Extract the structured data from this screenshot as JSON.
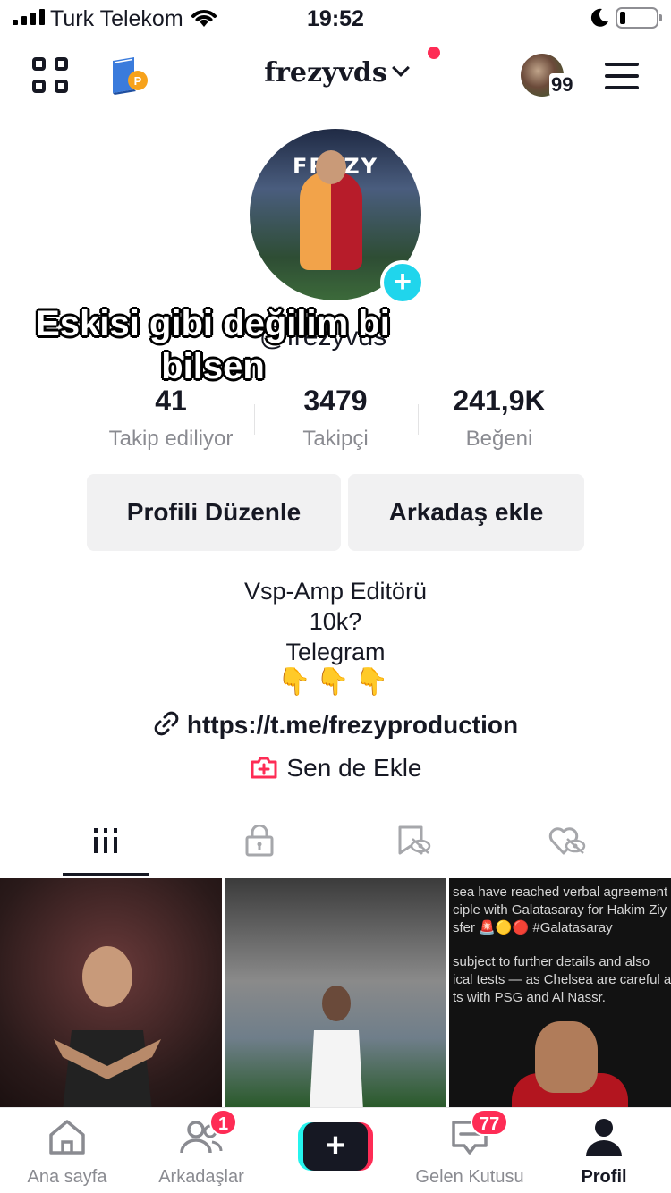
{
  "status_bar": {
    "carrier": "Turk Telekom",
    "time": "19:52"
  },
  "header": {
    "username": "frezyvds",
    "story_count": "99",
    "icons": [
      "qr-code-icon",
      "book-coin-icon",
      "chevron-down-icon",
      "menu-icon"
    ]
  },
  "profile": {
    "avatar_text": "FREZY",
    "handle": "@frezyvds",
    "overlay_caption": "Eskisi gibi değilim bi bilsen",
    "stats": [
      {
        "value": "41",
        "label": "Takip ediliyor"
      },
      {
        "value": "3479",
        "label": "Takipçi"
      },
      {
        "value": "241,9K",
        "label": "Beğeni"
      }
    ],
    "buttons": {
      "edit": "Profili Düzenle",
      "add_friend": "Arkadaş ekle"
    },
    "bio_lines": [
      "Vsp-Amp Editörü",
      "10k?",
      "Telegram",
      "👇👇👇"
    ],
    "link": "https://t.me/frezyproduction",
    "add_prompt": "Sen de Ekle"
  },
  "tabs": [
    "grid-icon",
    "lock-icon",
    "bookmark-hidden-icon",
    "heart-hidden-icon"
  ],
  "grid": {
    "tweet_lines": [
      "sea have reached verbal agreement",
      "ciple with Galatasaray for Hakim Ziy",
      "sfer 🚨🟡🔴 #Galatasaray",
      "",
      "subject to further details and also",
      "ical tests — as Chelsea are careful a",
      "ts with PSG and Al Nassr."
    ]
  },
  "bottom_nav": {
    "items": [
      {
        "label": "Ana sayfa",
        "icon": "home-icon"
      },
      {
        "label": "Arkadaşlar",
        "icon": "friends-icon",
        "badge": "1"
      },
      {
        "label": "",
        "icon": "create-plus-icon"
      },
      {
        "label": "Gelen Kutusu",
        "icon": "inbox-icon",
        "badge": "77"
      },
      {
        "label": "Profil",
        "icon": "profile-icon"
      }
    ]
  },
  "colors": {
    "accent_red": "#fe2c55",
    "accent_cyan": "#20d5ec",
    "text_primary": "#161823",
    "text_secondary": "#8a8b91"
  }
}
